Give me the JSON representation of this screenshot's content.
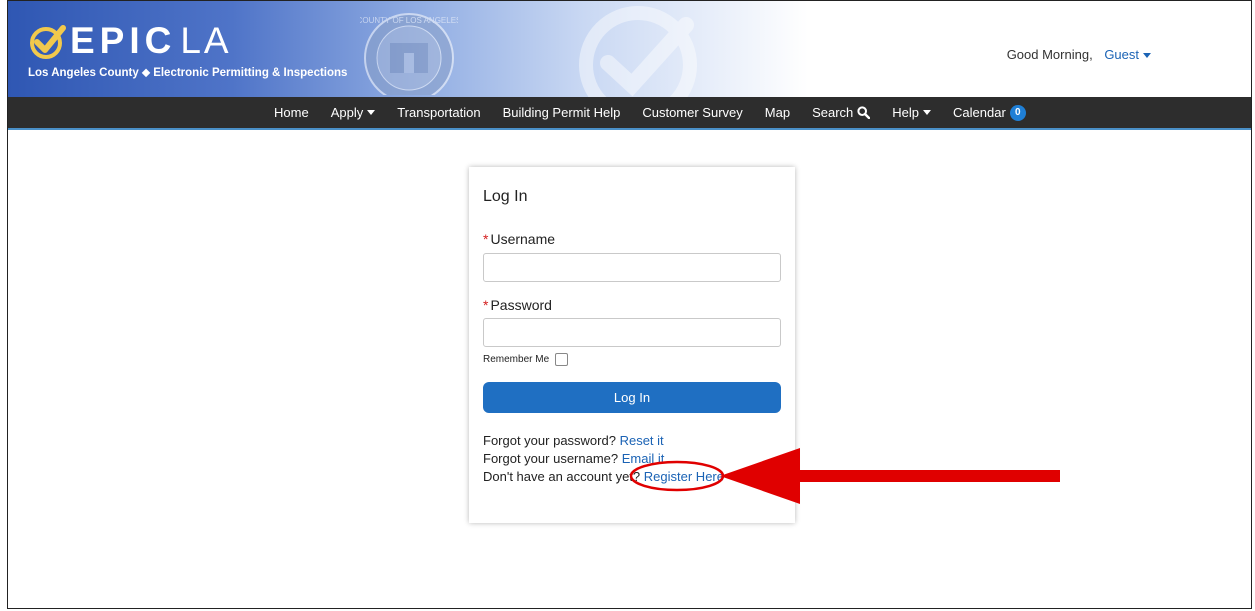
{
  "brand": {
    "name_bold": "EPIC",
    "name_light": "LA",
    "tagline": "Los Angeles County ⬥ Electronic Permitting & Inspections"
  },
  "greeting": {
    "text": "Good Morning,",
    "user": "Guest"
  },
  "nav": {
    "items": [
      {
        "label": "Home"
      },
      {
        "label": "Apply"
      },
      {
        "label": "Transportation"
      },
      {
        "label": "Building Permit Help"
      },
      {
        "label": "Customer Survey"
      },
      {
        "label": "Map"
      },
      {
        "label": "Search"
      },
      {
        "label": "Help"
      },
      {
        "label": "Calendar"
      }
    ],
    "calendar_count": "0"
  },
  "login": {
    "title": "Log In",
    "required_mark": "*",
    "username_label": "Username",
    "username_value": "",
    "password_label": "Password",
    "password_value": "",
    "remember_label": "Remember Me",
    "button_label": "Log In",
    "forgot_password_text": "Forgot your password?",
    "forgot_password_link": "Reset it",
    "forgot_username_text": "Forgot your username?",
    "forgot_username_link": "Email it",
    "no_account_text": "Don't have an account yet?",
    "register_link": "Register Here"
  },
  "colors": {
    "nav_bg": "#2d2d2d",
    "link": "#1b63b5",
    "button": "#1f6fc2",
    "annotation": "#e00000"
  }
}
